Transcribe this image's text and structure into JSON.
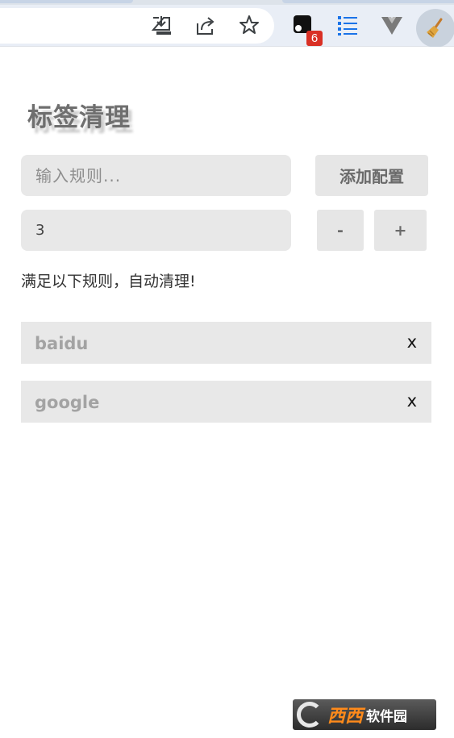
{
  "browser": {
    "toolbar_icons": [
      "download-icon",
      "share-icon",
      "bookmark-star-icon",
      "extension-icon",
      "list-icon",
      "vue-devtools-icon",
      "broom-icon"
    ],
    "extension_badge": "6",
    "colors": {
      "toolbar_bg": "#e9eef6",
      "badge_bg": "#d93025",
      "list_icon": "#1a73e8",
      "broom_circle": "#c9d2dd"
    }
  },
  "popup": {
    "title": "标签清理",
    "rule_input": {
      "placeholder": "输入规则...",
      "value": ""
    },
    "add_button": "添加配置",
    "count_value": "3",
    "minus_button": "-",
    "plus_button": "+",
    "info": "满足以下规则，自动清理!",
    "rules": [
      {
        "name": "baidu",
        "remove": "x"
      },
      {
        "name": "google",
        "remove": "x"
      }
    ],
    "colors": {
      "input_bg": "#e8e8e8",
      "title": "#6f6f6f",
      "rule_text": "#a3a3a3"
    }
  },
  "watermark": {
    "text_main": "西西",
    "text_secondary": "软件园"
  }
}
